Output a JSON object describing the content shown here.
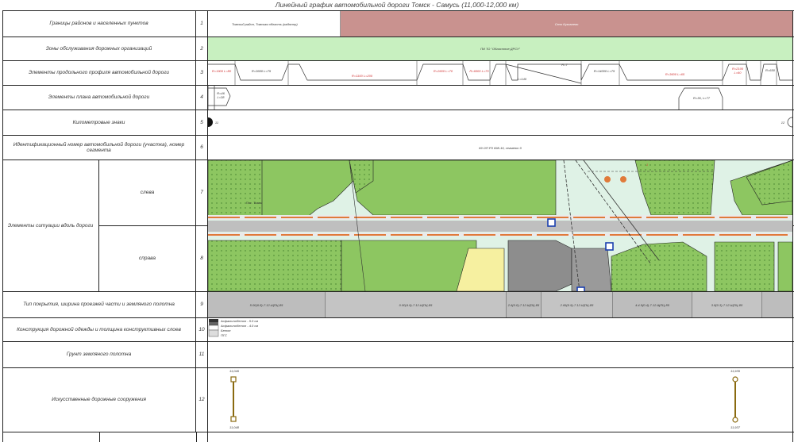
{
  "title": "Линейный график автомобильной дороги Томск - Самусь (11,000-12,000 км)",
  "rows": [
    {
      "num": "1",
      "label": "Границы районов и населенных пунктов"
    },
    {
      "num": "2",
      "label": "Зоны обслуживания дорожных организаций"
    },
    {
      "num": "3",
      "label": "Элементы продольного профиля автомобильной дороги"
    },
    {
      "num": "4",
      "label": "Элементы плана автомобильной дороги"
    },
    {
      "num": "5",
      "label": "Километровые знаки"
    },
    {
      "num": "6",
      "label": "Идентификационный номер автомобильной дороги (участка), номер сегмента"
    },
    {
      "num": "7",
      "label": "слева"
    },
    {
      "num": "8",
      "label": "справа"
    },
    {
      "num": "9",
      "label": "Тип покрытия, ширина проезжей части и земляного полотна"
    },
    {
      "num": "10",
      "label": "Конструкция дорожной одежды и толщина конструктивных слоев"
    },
    {
      "num": "11",
      "label": "Грунт земляного полотна"
    },
    {
      "num": "12",
      "label": "Искусственные дорожные сооружения"
    }
  ],
  "situation_group_label": "Элементы ситуации вдоль дороги",
  "row1": {
    "district": "Томский район, Томская область (кадастр)",
    "village": "Село Кузовлево"
  },
  "row2": {
    "org": "ПИ ТО \"Областное ДРСУ\""
  },
  "row3": {
    "profile_labels": [
      "R=1900 L=80",
      "R=3650 L=75",
      "R=1100 L=200",
      "R=2600 L=70",
      "R=6000 L=70",
      "R=7",
      "L=140",
      "R=14000 L=75",
      "R=3600 L=65",
      "R=2100 L=60",
      "R=650"
    ]
  },
  "row4": {
    "curve_left": "R=46 L=38",
    "curve_right": "R=36, L=77"
  },
  "row5": {
    "km_left": "11",
    "km_right": "12"
  },
  "row6": {
    "id": "69 ОП РЗ 69К-16, сегмент 0"
  },
  "row9": {
    "segments": [
      "5.00(6.8)-7.12-ЩПЦ-85",
      "0.00(4.9)-7.12-ЩПЦ-85",
      "2.6(0.0)-7.12-ЩПЦ-85",
      "2.69(0.9)-7.12-ЩПЦ-85",
      "4.4.5(0.4)-7.12-ЩПЦ-85",
      "3.8(0.3)-7.12-ЩПЦ-85"
    ]
  },
  "row10": {
    "layers": [
      "Асфальтобетон - 5.0 см",
      "Асфальтобетон - 4.0 см",
      "Бетон",
      "ПГС"
    ]
  },
  "row12": {
    "left_top": "11,046",
    "left_bottom": "11,048",
    "right_top": "11,935",
    "right_bottom": "11,937"
  },
  "map_labels": {
    "road_label": "Пос. Томск",
    "crossing_num": "1"
  },
  "colors": {
    "village": "#c9928f",
    "org_zone": "#c8f0c0",
    "green": "#8dc661",
    "green_dark": "#7ab850",
    "road": "#bfbfbf",
    "building": "#8d8d8d",
    "sand": "#f6f0a0",
    "light_green": "#dff2e6",
    "profile_red": "#d03030"
  }
}
